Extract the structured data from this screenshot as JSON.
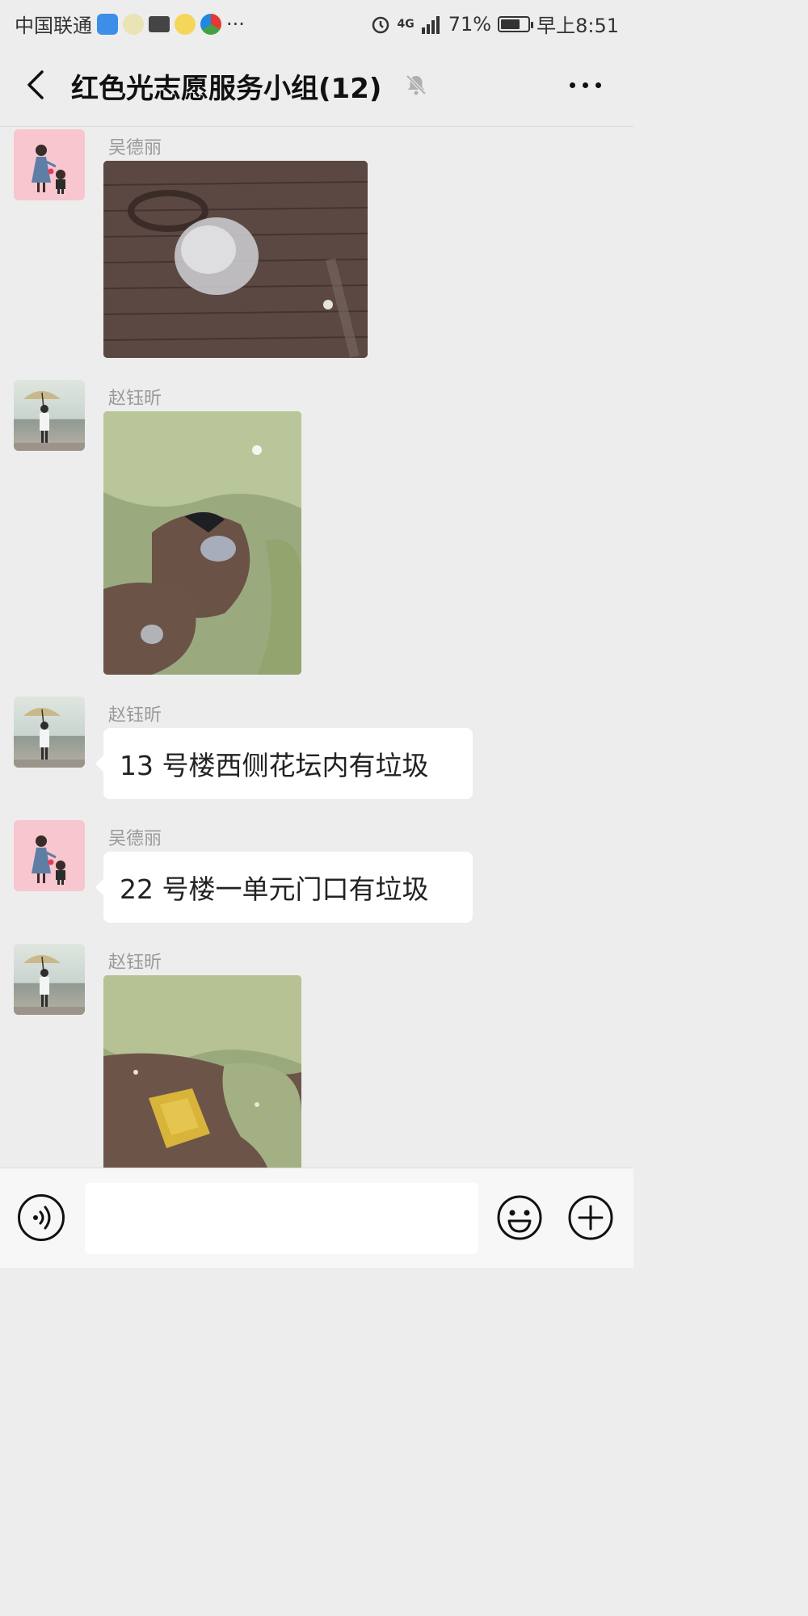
{
  "status_bar": {
    "carrier": "中国联通",
    "more_notifications": "···",
    "network": "4G",
    "battery": "71%",
    "battery_level": 0.71,
    "time": "早上8:51"
  },
  "header": {
    "title": "红色光志愿服务小组(12)"
  },
  "messages": [
    {
      "sender": "吴德丽",
      "type": "image",
      "avatar": "avatar-woman-child",
      "image_subject": "paving-stones-with-trash"
    },
    {
      "sender": "赵钰昕",
      "type": "image",
      "avatar": "avatar-person-umbrella",
      "image_subject": "shrubs-with-litter"
    },
    {
      "sender": "赵钰昕",
      "type": "text",
      "avatar": "avatar-person-umbrella",
      "text": "13 号楼西侧花坛内有垃圾"
    },
    {
      "sender": "吴德丽",
      "type": "text",
      "avatar": "avatar-woman-child",
      "text": "22 号楼一单元门口有垃圾"
    },
    {
      "sender": "赵钰昕",
      "type": "image",
      "avatar": "avatar-person-umbrella",
      "image_subject": "shrubs-with-yellow-bag"
    }
  ],
  "input": {
    "value": ""
  },
  "icons": {
    "back": "back-arrow-icon",
    "mute": "muted-bell-icon",
    "more": "more-icon",
    "voice": "voice-icon",
    "emoji": "emoji-icon",
    "plus": "plus-icon"
  },
  "colors": {
    "background": "#ededed",
    "bubble": "#ffffff",
    "sender_name": "#9a9a9a",
    "input_bar": "#f7f7f7"
  }
}
